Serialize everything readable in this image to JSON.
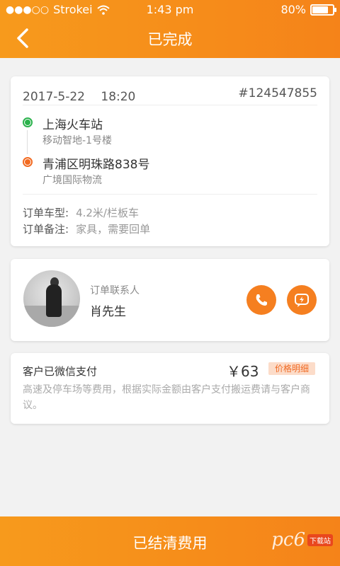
{
  "status_bar": {
    "carrier": "Strokei",
    "time": "1:43 pm",
    "battery": "80%",
    "battery_level": 0.8
  },
  "header": {
    "title": "已完成"
  },
  "order": {
    "datetime": "2017-5-22　 18:20",
    "number": "#124547855",
    "from": {
      "name": "上海火车站",
      "detail": "移动智地-1号楼"
    },
    "to": {
      "name": "青浦区明珠路838号",
      "detail": "广境国际物流"
    },
    "vehicle_label": "订单车型:",
    "vehicle_value": "4.2米/栏板车",
    "remark_label": "订单备注:",
    "remark_value": "家具，需要回单"
  },
  "contact": {
    "label": "订单联系人",
    "name": "肖先生"
  },
  "payment": {
    "title": "客户已微信支付",
    "price": "￥63",
    "detail_tag": "价格明细",
    "note": "高速及停车场等费用，根据实际金额由客户支付搬运费请与客户商议。"
  },
  "footer": {
    "button_label": "已结清费用",
    "watermark": "pc6",
    "watermark_tag": "下载站"
  },
  "colors": {
    "accent": "#f58319",
    "green": "#2bb24c",
    "orange_dot": "#f26a21"
  }
}
